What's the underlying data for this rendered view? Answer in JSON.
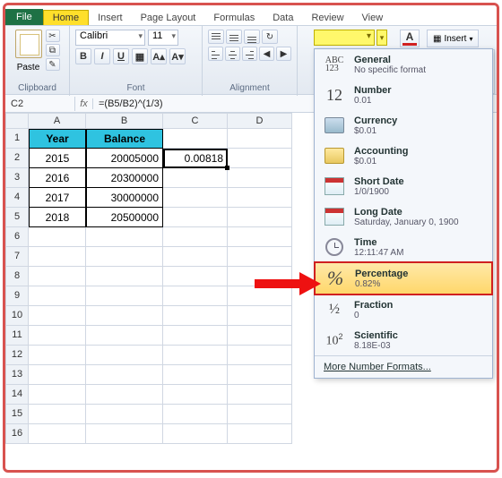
{
  "tabs": {
    "file": "File",
    "home": "Home",
    "insert": "Insert",
    "pagelayout": "Page Layout",
    "formulas": "Formulas",
    "data": "Data",
    "review": "Review",
    "view": "View"
  },
  "ribbon": {
    "clipboard_label": "Clipboard",
    "paste_label": "Paste",
    "font_label": "Font",
    "font_name": "Calibri",
    "font_size": "11",
    "alignment_label": "Alignment",
    "insert_label": "Insert"
  },
  "namebox": "C2",
  "fx": "fx",
  "formula": "=(B5/B2)^(1/3)",
  "columns": [
    "A",
    "B",
    "C",
    "D"
  ],
  "rows": [
    "1",
    "2",
    "3",
    "4",
    "5",
    "6",
    "7",
    "8",
    "9",
    "10",
    "11",
    "12",
    "13",
    "14",
    "15",
    "16"
  ],
  "header": {
    "a": "Year",
    "b": "Balance"
  },
  "data": [
    {
      "year": "2015",
      "bal": "20005000"
    },
    {
      "year": "2016",
      "bal": "20300000"
    },
    {
      "year": "2017",
      "bal": "30000000"
    },
    {
      "year": "2018",
      "bal": "20500000"
    }
  ],
  "c2": "0.00818",
  "numfmt": [
    {
      "k": "general",
      "t": "General",
      "s": "No specific format",
      "icon": "gen"
    },
    {
      "k": "number",
      "t": "Number",
      "s": "0.01",
      "icon": "num"
    },
    {
      "k": "currency",
      "t": "Currency",
      "s": "$0.01",
      "icon": "cur"
    },
    {
      "k": "accounting",
      "t": "Accounting",
      "s": "$0.01",
      "icon": "acc"
    },
    {
      "k": "shortdate",
      "t": "Short Date",
      "s": "1/0/1900",
      "icon": "cal"
    },
    {
      "k": "longdate",
      "t": "Long Date",
      "s": "Saturday, January 0, 1900",
      "icon": "cal"
    },
    {
      "k": "time",
      "t": "Time",
      "s": "12:11:47 AM",
      "icon": "clock"
    },
    {
      "k": "percentage",
      "t": "Percentage",
      "s": "0.82%",
      "icon": "pct",
      "hl": true
    },
    {
      "k": "fraction",
      "t": "Fraction",
      "s": "0",
      "icon": "frac"
    },
    {
      "k": "scientific",
      "t": "Scientific",
      "s": "8.18E-03",
      "icon": "sci"
    }
  ],
  "more": "More Number Formats..."
}
